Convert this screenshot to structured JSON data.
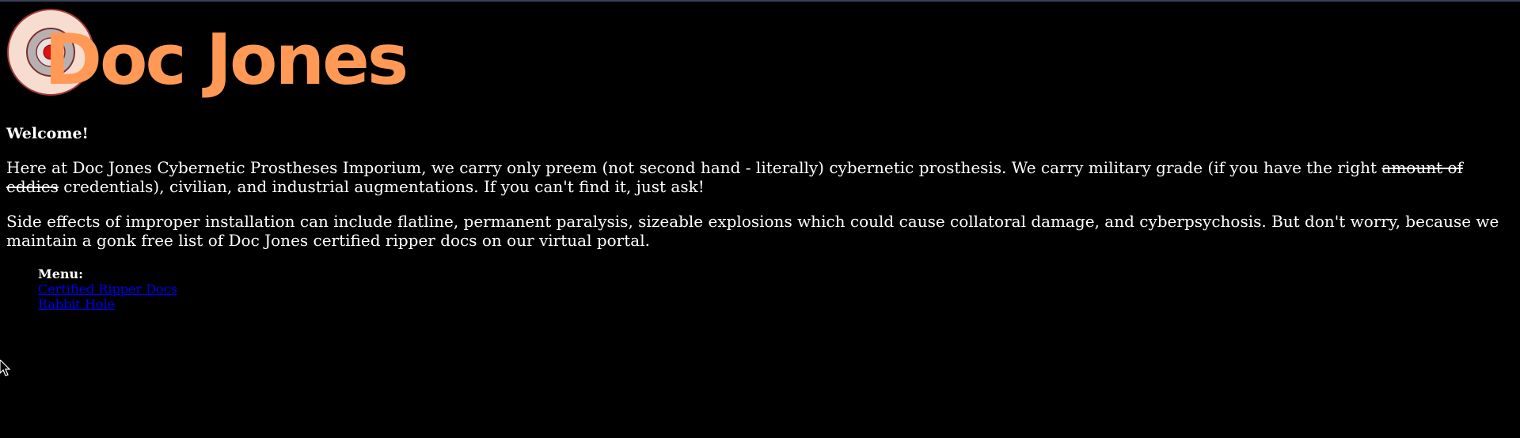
{
  "header": {
    "logo_text": "Doc Jones",
    "logo_icon": "target-icon",
    "brand_color": "#ff9955"
  },
  "content": {
    "welcome": "Welcome!",
    "paragraph1": {
      "before": "Here at Doc Jones Cybernetic Prostheses Imporium, we carry only preem (not second hand - literally) cybernetic prosthesis. We carry military grade (if you have the right ",
      "struck": "amount of eddies",
      "after": " credentials), civilian, and industrial augmentations. If you can't find it, just ask!"
    },
    "paragraph2": "Side effects of improper installation can include flatline, permanent paralysis, sizeable explosions which could cause collatoral damage, and cyberpsychosis. But don't worry, because we maintain a gonk free list of Doc Jones certified ripper docs on our virtual portal."
  },
  "menu": {
    "title": "Menu:",
    "items": [
      {
        "label": "Certified Ripper Docs"
      },
      {
        "label": "Rabbit Hole"
      }
    ]
  },
  "colors": {
    "background": "#000000",
    "text": "#ffffff",
    "link": "#0000ee"
  }
}
